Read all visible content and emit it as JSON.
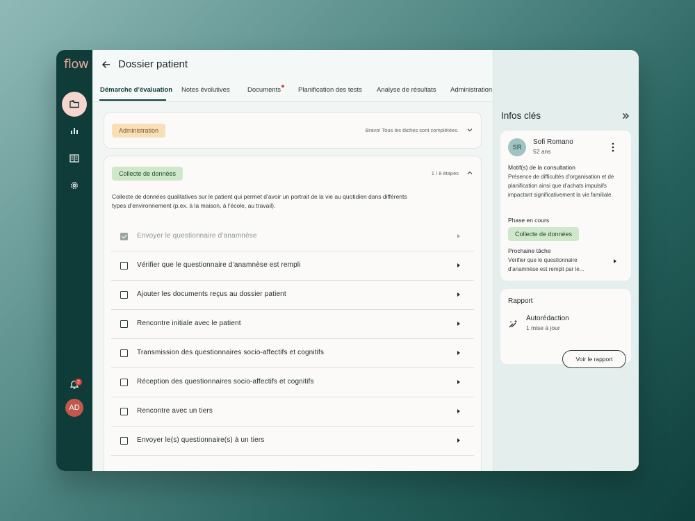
{
  "app": {
    "logo": "flow"
  },
  "nav": {
    "items": [
      {
        "name": "folder-icon",
        "active": true
      },
      {
        "name": "bar-chart-icon",
        "active": false
      },
      {
        "name": "building-icon",
        "active": false
      },
      {
        "name": "gear-icon",
        "active": false
      }
    ],
    "notifications_count": "2",
    "user_initials": "AD"
  },
  "header": {
    "title": "Dossier patient",
    "tabs": [
      {
        "label": "Démarche d’évaluation",
        "active": true
      },
      {
        "label": "Notes évolutives"
      },
      {
        "label": "Documents",
        "has_dot": true
      },
      {
        "label": "Planification des tests"
      },
      {
        "label": "Analyse de résultats"
      },
      {
        "label": "Administration"
      }
    ]
  },
  "main": {
    "admin_card": {
      "pill": "Administration",
      "status": "Bravo! Tous les tâches sont complétées."
    },
    "collect_card": {
      "pill": "Collecte de données",
      "progress": "1 / 8 étapes",
      "description": "Collecte de données qualitatives sur le patient qui permet d’avoir un portrait de la vie au quotidien dans différents types d’environnement (p.ex. à la maison, à l’école, au travail).",
      "tasks": [
        {
          "label": "Envoyer le questionnaire d’anamnèse",
          "done": true
        },
        {
          "label": "Vérifier que le questionnaire d’anamnèse est rempli",
          "done": false
        },
        {
          "label": "Ajouter les documents reçus au dossier patient",
          "done": false
        },
        {
          "label": "Rencontre initiale avec le patient",
          "done": false
        },
        {
          "label": "Transmission des questionnaires socio-affectifs et cognitifs",
          "done": false
        },
        {
          "label": "Réception des questionnaires socio-affectifs et cognitifs",
          "done": false
        },
        {
          "label": "Rencontre avec un tiers",
          "done": false
        },
        {
          "label": "Envoyer le(s) questionnaire(s) à un tiers",
          "done": false
        }
      ]
    }
  },
  "side": {
    "title": "Infos clés",
    "patient": {
      "initials": "SR",
      "name": "Sofi Romano",
      "age": "52 ans",
      "reason_label": "Motif(s) de la consultation",
      "reason_text": "Présence de difficultés d’organisation et de planification ainsi que d’achats impulsifs impactant significativement la vie familiale.",
      "phase_label": "Phase en cours",
      "phase_value": "Collecte de données",
      "next_label": "Prochaine tâche",
      "next_text": "Vérifier que le questionnaire d’anamnèse est rempli par le..."
    },
    "report": {
      "title": "Rapport",
      "type": "Autorédaction",
      "updates": "1 mise à jour",
      "button": "Voir le rapport"
    }
  },
  "colors": {
    "rail": "#0f3b38",
    "accent_pink": "#f6d5cf",
    "pill_orange": "#f9dfb8",
    "pill_green": "#cfe8c9",
    "badge_red": "#d9453b"
  }
}
